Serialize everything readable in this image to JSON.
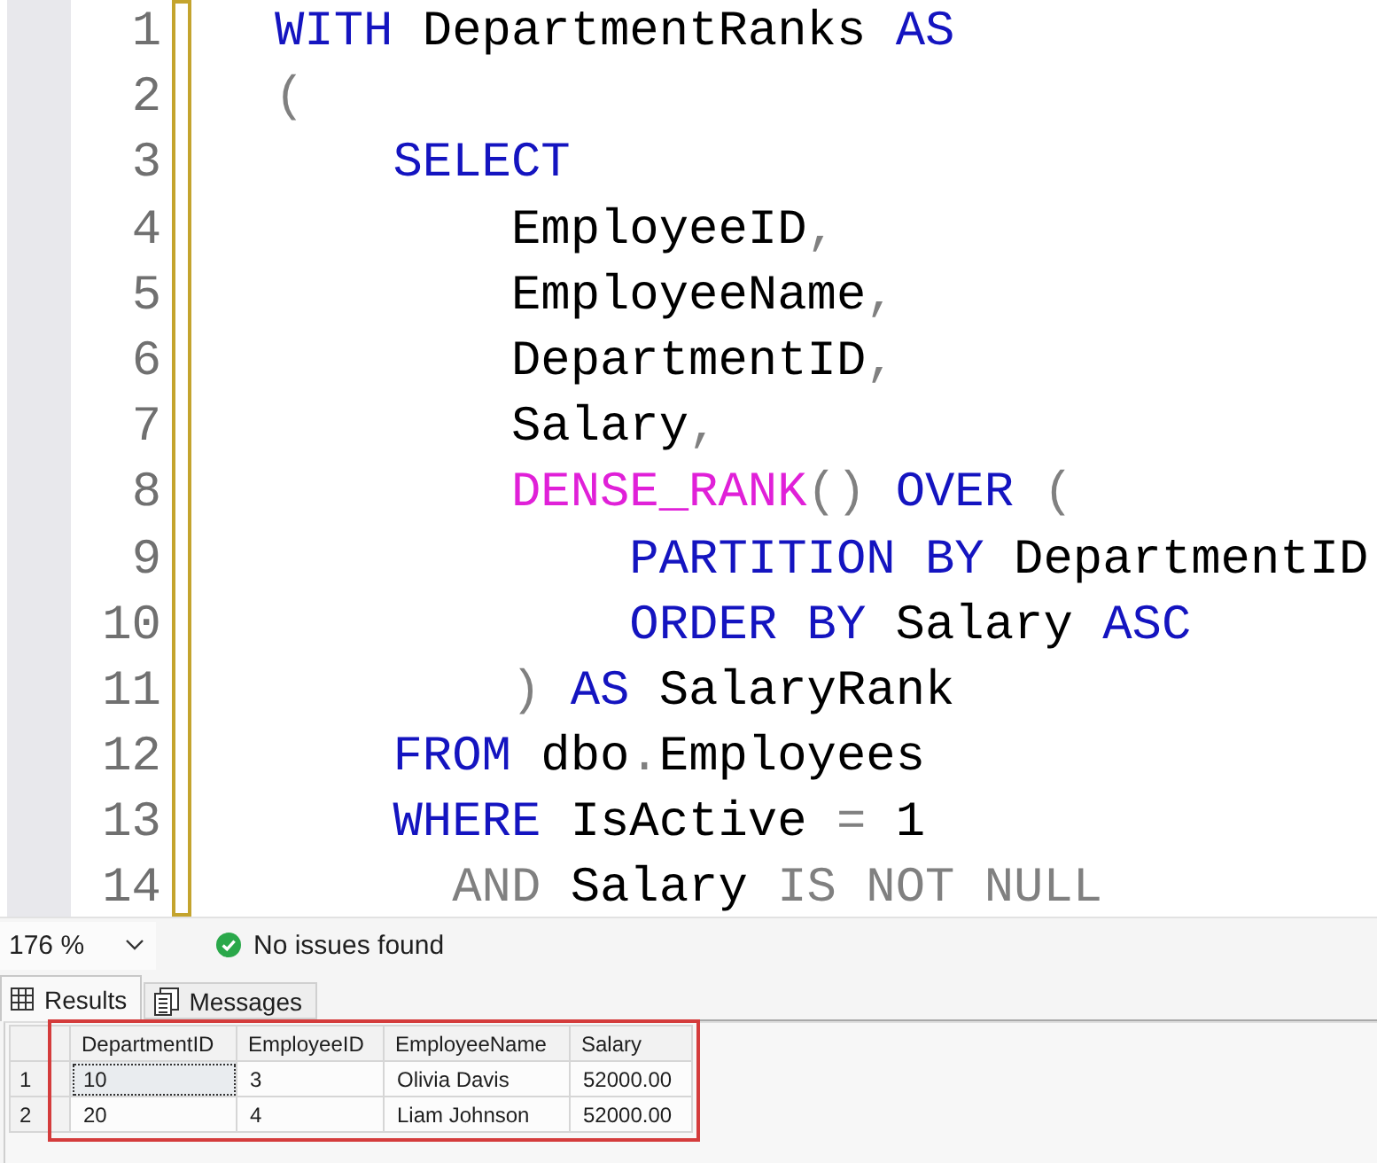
{
  "editor": {
    "lines": [
      {
        "number": "1",
        "tokens": [
          {
            "kind": "keyword",
            "text": "WITH"
          },
          {
            "kind": "identifier",
            "text": " DepartmentRanks"
          },
          {
            "kind": "keyword",
            "text": " AS"
          }
        ]
      },
      {
        "number": "2",
        "tokens": [
          {
            "kind": "punctuation",
            "text": "("
          }
        ]
      },
      {
        "number": "3",
        "tokens": [
          {
            "kind": "keyword",
            "text": "    SELECT"
          }
        ]
      },
      {
        "number": "4",
        "tokens": [
          {
            "kind": "identifier",
            "text": "        EmployeeID"
          },
          {
            "kind": "punctuation",
            "text": ","
          }
        ]
      },
      {
        "number": "5",
        "tokens": [
          {
            "kind": "identifier",
            "text": "        EmployeeName"
          },
          {
            "kind": "punctuation",
            "text": ","
          }
        ]
      },
      {
        "number": "6",
        "tokens": [
          {
            "kind": "identifier",
            "text": "        DepartmentID"
          },
          {
            "kind": "punctuation",
            "text": ","
          }
        ]
      },
      {
        "number": "7",
        "tokens": [
          {
            "kind": "identifier",
            "text": "        Salary"
          },
          {
            "kind": "punctuation",
            "text": ","
          }
        ]
      },
      {
        "number": "8",
        "tokens": [
          {
            "kind": "function",
            "text": "        DENSE_RANK"
          },
          {
            "kind": "punctuation",
            "text": "()"
          },
          {
            "kind": "keyword",
            "text": " OVER"
          },
          {
            "kind": "punctuation",
            "text": " ("
          }
        ]
      },
      {
        "number": "9",
        "tokens": [
          {
            "kind": "keyword",
            "text": "            PARTITION BY"
          },
          {
            "kind": "identifier",
            "text": " DepartmentID"
          }
        ]
      },
      {
        "number": "10",
        "tokens": [
          {
            "kind": "keyword",
            "text": "            ORDER BY"
          },
          {
            "kind": "identifier",
            "text": " Salary"
          },
          {
            "kind": "keyword",
            "text": " ASC"
          }
        ]
      },
      {
        "number": "11",
        "tokens": [
          {
            "kind": "punctuation",
            "text": "        )"
          },
          {
            "kind": "keyword",
            "text": " AS"
          },
          {
            "kind": "identifier",
            "text": " SalaryRank"
          }
        ]
      },
      {
        "number": "12",
        "tokens": [
          {
            "kind": "keyword",
            "text": "    FROM"
          },
          {
            "kind": "identifier",
            "text": " dbo"
          },
          {
            "kind": "punctuation",
            "text": "."
          },
          {
            "kind": "identifier",
            "text": "Employees"
          }
        ]
      },
      {
        "number": "13",
        "tokens": [
          {
            "kind": "keyword",
            "text": "    WHERE"
          },
          {
            "kind": "identifier",
            "text": " IsActive"
          },
          {
            "kind": "operator",
            "text": " ="
          },
          {
            "kind": "identifier",
            "text": " 1"
          }
        ]
      },
      {
        "number": "14",
        "tokens": [
          {
            "kind": "operator",
            "text": "      AND"
          },
          {
            "kind": "identifier",
            "text": " Salary"
          },
          {
            "kind": "operator",
            "text": " IS NOT NULL"
          }
        ]
      }
    ]
  },
  "status_bar": {
    "zoom": "176 %",
    "message": "No issues found"
  },
  "tabs": [
    {
      "label": "Results",
      "kind": "grid",
      "selected": true
    },
    {
      "label": "Messages",
      "kind": "messages",
      "selected": false
    }
  ],
  "results": {
    "columns": [
      "DepartmentID",
      "EmployeeID",
      "EmployeeName",
      "Salary"
    ],
    "rows": [
      {
        "number": "1",
        "cells": [
          {
            "text": "10",
            "selected": true
          },
          {
            "text": "3",
            "selected": false
          },
          {
            "text": "Olivia Davis",
            "selected": false
          },
          {
            "text": "52000.00",
            "selected": false
          }
        ]
      },
      {
        "number": "2",
        "cells": [
          {
            "text": "20",
            "selected": false
          },
          {
            "text": "4",
            "selected": false
          },
          {
            "text": "Liam Johnson",
            "selected": false
          },
          {
            "text": "52000.00",
            "selected": false
          }
        ]
      }
    ]
  }
}
